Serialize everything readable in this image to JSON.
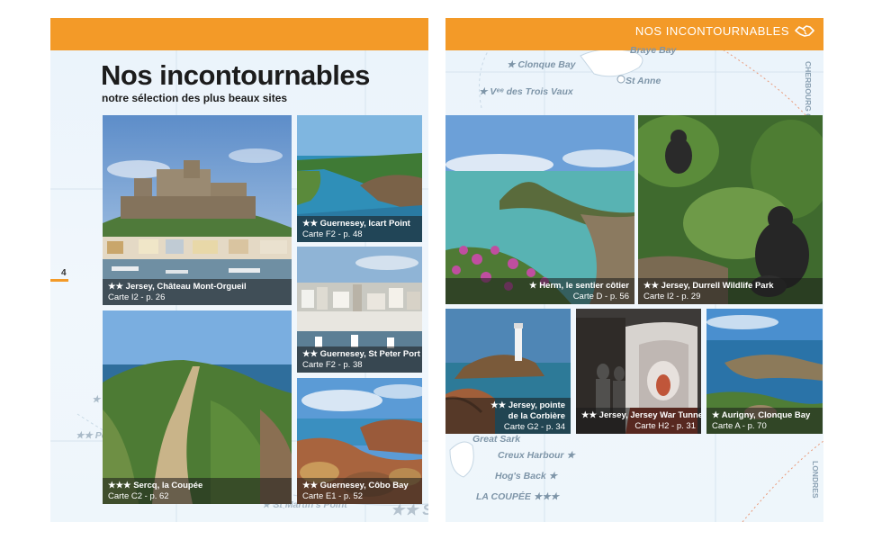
{
  "left_page": {
    "title": "Nos incontournables",
    "subtitle": "notre sélection des plus beaux sites",
    "page_number": "4",
    "photos": [
      {
        "title": "★★ Jersey, Château Mont-Orgueil",
        "ref": "Carte I2 - p. 26"
      },
      {
        "title": "★★ Guernesey, Icart Point",
        "ref": "Carte F2 - p. 48"
      },
      {
        "title": "★★ Guernesey, St Peter Port",
        "ref": "Carte F2 - p. 38"
      },
      {
        "title": "★★★ Sercq, la Coupée",
        "ref": "Carte C2 - p. 62"
      },
      {
        "title": "★★ Guernesey, Côbo Bay",
        "ref": "Carte E1 - p. 52"
      }
    ],
    "map_labels": {
      "st_martins_point": "★ St Martin's Point",
      "sark": "★★ SARK",
      "pe": "★★ Pe",
      "stars": "★"
    }
  },
  "right_page": {
    "header": "NOS INCONTOURNABLES",
    "header_icon": "handshake-icon",
    "photos": [
      {
        "title": "★ Herm, le sentier côtier",
        "ref": "Carte D - p. 56"
      },
      {
        "title": "★★ Jersey, Durrell Wildlife Park",
        "ref": "Carte I2 - p. 29"
      },
      {
        "title_line1": "★★ Jersey, pointe",
        "title_line2": "de la Corbière",
        "ref": "Carte G2 - p. 34"
      },
      {
        "title": "★★ Jersey, Jersey War Tunnels",
        "ref": "Carte H2 - p. 31"
      },
      {
        "title": "★ Aurigny, Clonque Bay",
        "ref": "Carte A - p. 70"
      }
    ],
    "map_labels": {
      "braye_bay": "Braye Bay",
      "clonque_bay": "★ Clonque Bay",
      "st_anne": "St Anne",
      "trois_vaux": "★ Vᵉᵉ des Trois Vaux",
      "cherbourg": "CHERBOURG OCTEVILLE",
      "great_sark": "Great Sark",
      "creux_harbour": "Creux Harbour ★",
      "hogs_back": "Hog's Back ★",
      "la_coupee": "LA COUPÉE ★★★",
      "londres": "LONDRES"
    }
  },
  "colors": {
    "accent_orange": "#f39a28",
    "caption_bg": "rgba(25,25,25,0.55)",
    "map_bg": "#eaf3fb",
    "map_label": "#7e95a8"
  }
}
